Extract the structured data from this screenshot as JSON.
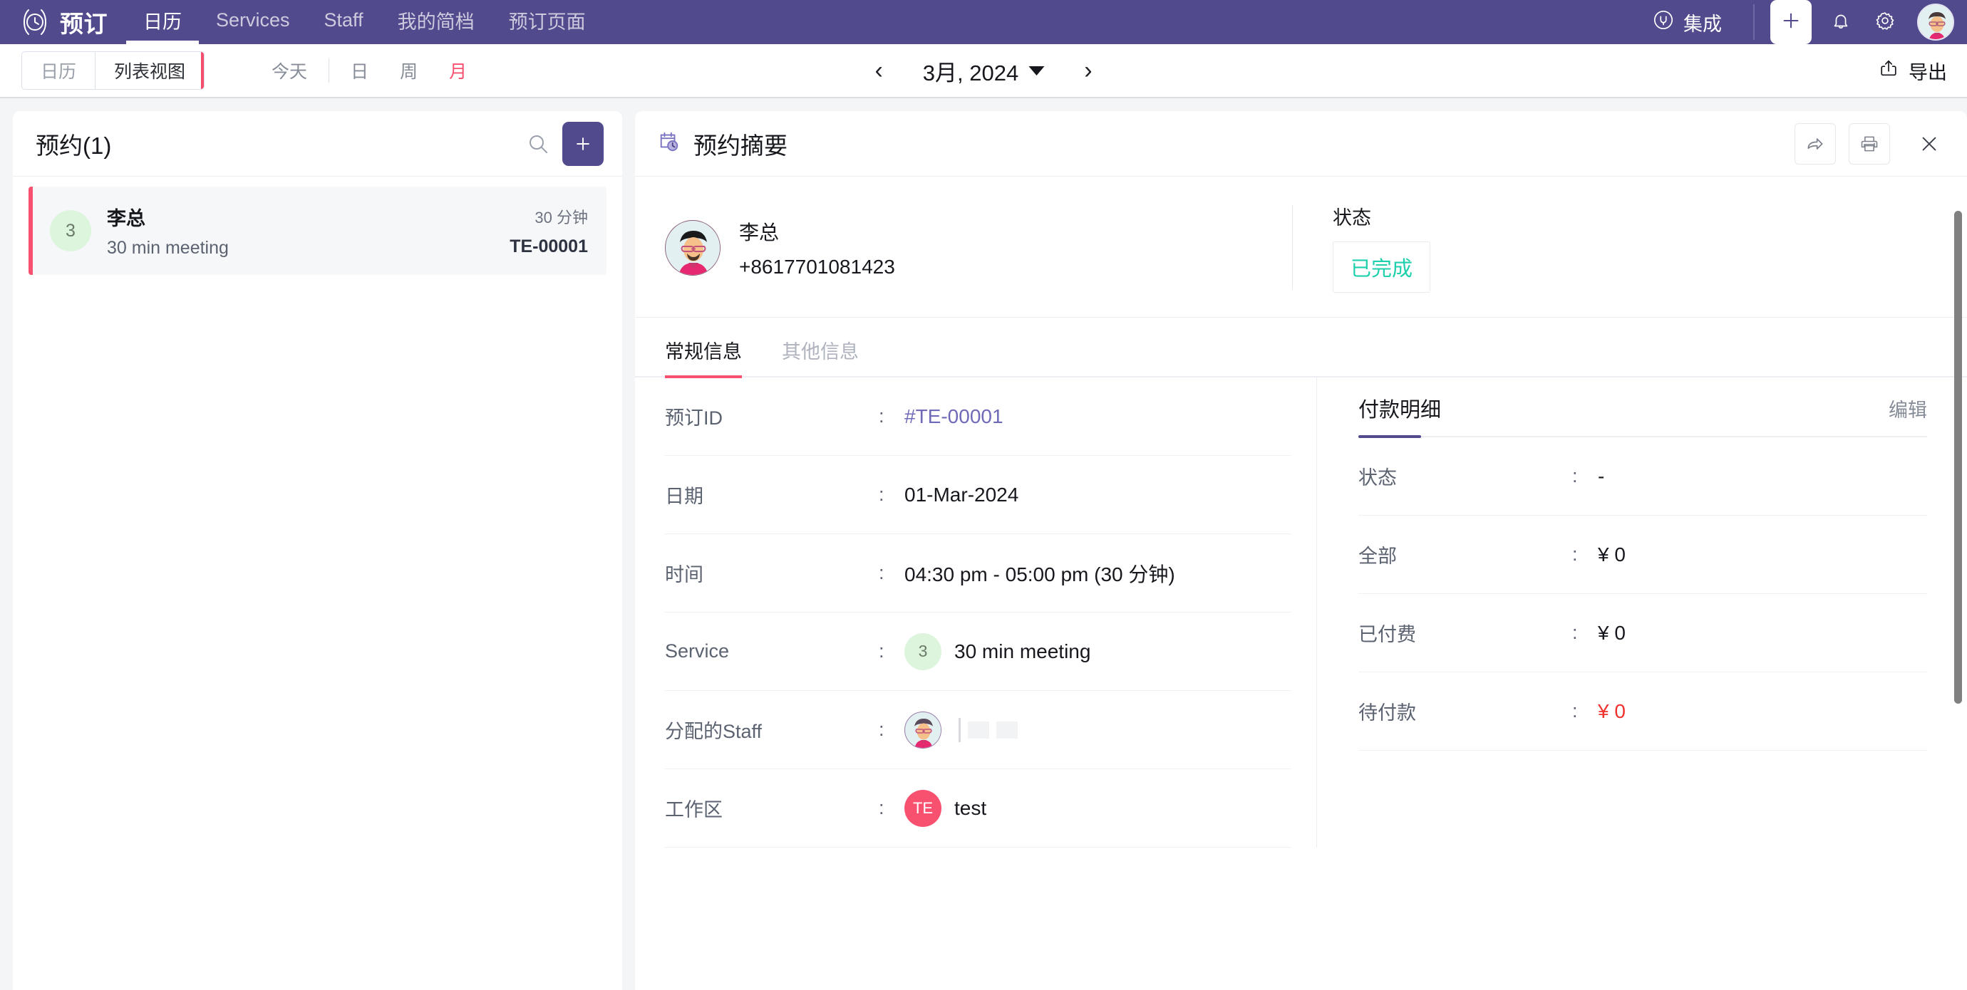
{
  "topnav": {
    "brand": "预订",
    "brand_icon": "clock-circle-icon",
    "items": [
      {
        "label": "日历",
        "active": true
      },
      {
        "label": "Services",
        "active": false
      },
      {
        "label": "Staff",
        "active": false
      },
      {
        "label": "我的简档",
        "active": false
      },
      {
        "label": "预订页面",
        "active": false
      }
    ],
    "integration_label": "集成",
    "integration_icon": "plug-icon",
    "add_icon": "plus-icon",
    "bell_icon": "bell-icon",
    "gear_icon": "gear-icon",
    "avatar_icon": "user-avatar",
    "background": "#514b8e"
  },
  "toolbar": {
    "view_toggle": [
      {
        "label": "日历",
        "active": false
      },
      {
        "label": "列表视图",
        "active": true
      }
    ],
    "ranges": [
      {
        "label": "今天",
        "active": false
      },
      {
        "label": "日",
        "active": false
      },
      {
        "label": "周",
        "active": false
      },
      {
        "label": "月",
        "active": true
      }
    ],
    "prev_icon": "chevron-left-icon",
    "next_icon": "chevron-right-icon",
    "date_label": "3月, 2024",
    "export_label": "导出",
    "export_icon": "share-upload-icon",
    "accent": "#f8506f"
  },
  "list_panel": {
    "title": "预约(1)",
    "search_icon": "search-icon",
    "add_icon": "plus-icon",
    "appointments": [
      {
        "badge": "3",
        "name": "李总",
        "service": "30 min meeting",
        "duration": "30 分钟",
        "code": "TE-00001"
      }
    ]
  },
  "detail_panel": {
    "title": "预约摘要",
    "title_icon": "calendar-clock-icon",
    "share_icon": "share-arrow-icon",
    "print_icon": "printer-icon",
    "close_icon": "close-icon",
    "customer": {
      "avatar_icon": "user-avatar",
      "name": "李总",
      "phone": "+8617701081423"
    },
    "status": {
      "label": "状态",
      "value": "已完成",
      "color": "#1fd0ad"
    },
    "tabs": [
      {
        "label": "常规信息",
        "active": true
      },
      {
        "label": "其他信息",
        "active": false
      }
    ],
    "general_rows": [
      {
        "label": "预订ID",
        "colon": ":",
        "value": "#TE-00001",
        "style": "link"
      },
      {
        "label": "日期",
        "colon": ":",
        "value": "01-Mar-2024",
        "style": "plain"
      },
      {
        "label": "时间",
        "colon": ":",
        "value": "04:30 pm - 05:00 pm (30 分钟)",
        "style": "plain"
      },
      {
        "label": "Service",
        "colon": ":",
        "value": "30 min meeting",
        "style": "service",
        "badge": "3"
      },
      {
        "label": "分配的Staff",
        "colon": ":",
        "value": "",
        "style": "staff"
      },
      {
        "label": "工作区",
        "colon": ":",
        "value": "test",
        "style": "workspace",
        "badge": "TE"
      }
    ],
    "payment": {
      "title": "付款明细",
      "edit_label": "编辑",
      "rows": [
        {
          "label": "状态",
          "colon": ":",
          "value": "-",
          "style": "plain"
        },
        {
          "label": "全部",
          "colon": ":",
          "value": "¥ 0",
          "style": "plain"
        },
        {
          "label": "已付费",
          "colon": ":",
          "value": "¥ 0",
          "style": "plain"
        },
        {
          "label": "待付款",
          "colon": ":",
          "value": "¥ 0",
          "style": "danger"
        }
      ]
    }
  }
}
